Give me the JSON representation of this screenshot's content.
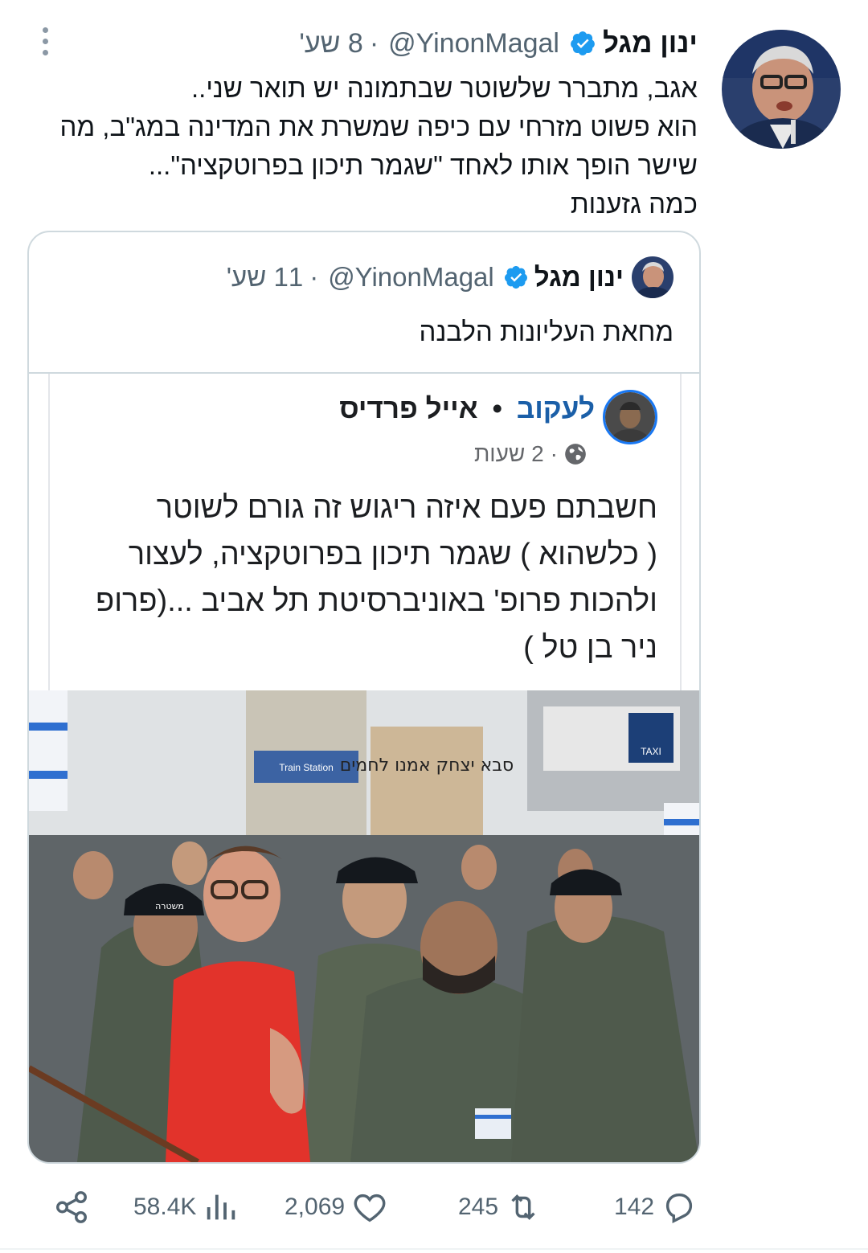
{
  "tweet": {
    "author_name": "ינון מגל",
    "handle": "@YinonMagal",
    "time": "8 שע'",
    "separator": "·",
    "body_lines": [
      "אגב, מתברר שלשוטר שבתמונה יש תואר שני..",
      "הוא פשוט מזרחי עם כיפה שמשרת את המדינה במג\"ב, מה",
      "שישר הופך אותו לאחד \"שגמר תיכון בפרוטקציה\"...",
      "כמה גזענות"
    ]
  },
  "quote": {
    "author_name": "ינון מגל",
    "handle": "@YinonMagal",
    "time": "11 שע'",
    "separator": "·",
    "text": "מחאת העליונות הלבנה",
    "embedded_post": {
      "author_name": "אייל פרדיס",
      "separator": "•",
      "follow_label": "לעקוב",
      "time": "2 שעות",
      "meta_separator": "·",
      "text_lines": [
        "חשבתם פעם איזה ריגוש זה גורם לשוטר",
        "( כלשהוא ) שגמר תיכון בפרוטקציה, לעצור",
        "ולהכות פרופ' באוניברסיטת תל אביב ...(פרופ",
        "ניר בן טל )"
      ]
    },
    "photo": {
      "sign_text": "סבא יצחק אמנו לחמים",
      "station_sign": "Train Station",
      "taxi_sign": "TAXI",
      "police_cap_label": "משטרה"
    }
  },
  "actions": {
    "replies": "142",
    "retweets": "245",
    "likes": "2,069",
    "views": "58.4K"
  },
  "colors": {
    "verified": "#1d9bf0",
    "secondary_text": "#536471",
    "fb_link": "#1b5fa8"
  }
}
